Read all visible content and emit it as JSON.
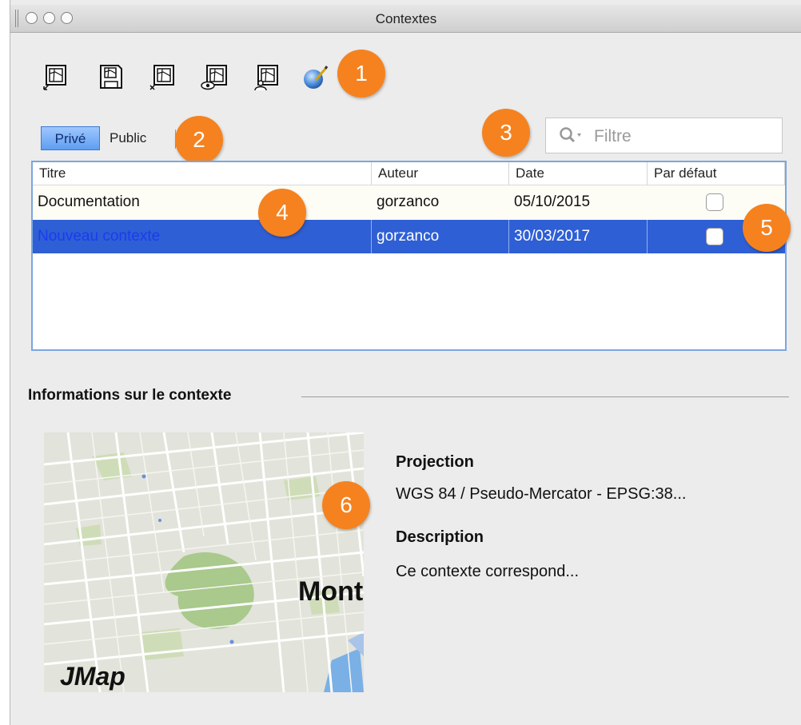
{
  "window": {
    "title": "Contextes"
  },
  "toolbar": {
    "buttons": [
      {
        "icon": "context-create-icon"
      },
      {
        "icon": "context-save-icon"
      },
      {
        "icon": "context-delete-icon"
      },
      {
        "icon": "context-preview-icon"
      },
      {
        "icon": "context-share-icon"
      },
      {
        "icon": "context-edit-icon"
      }
    ]
  },
  "tabs": {
    "private": "Privé",
    "public": "Public"
  },
  "filter": {
    "placeholder": "Filtre",
    "value": ""
  },
  "table": {
    "headers": {
      "title": "Titre",
      "author": "Auteur",
      "date": "Date",
      "default": "Par défaut"
    },
    "rows": [
      {
        "title": "Documentation",
        "author": "gorzanco",
        "date": "05/10/2015",
        "default": false
      },
      {
        "title": "Nouveau contexte",
        "author": "gorzanco",
        "date": "30/03/2017",
        "default": false
      }
    ]
  },
  "info": {
    "section_title": "Informations sur le contexte",
    "projection_label": "Projection",
    "projection_value": "WGS 84 / Pseudo-Mercator - EPSG:38...",
    "description_label": "Description",
    "description_value": "Ce contexte correspond...",
    "map_city": "Mont",
    "map_brand": "JMap"
  },
  "callouts": [
    "1",
    "2",
    "3",
    "4",
    "5",
    "6"
  ],
  "colors": {
    "callout": "#f5821f",
    "selection": "#2f5fd4",
    "tab_active": "#5f9ef0"
  }
}
